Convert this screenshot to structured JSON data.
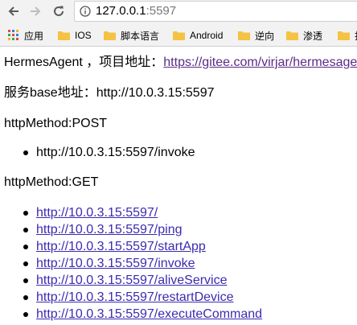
{
  "browser": {
    "url_host": "127.0.0.1",
    "url_port": ":5597",
    "bookmarks": [
      {
        "label": "应用",
        "icon": "apps-grid-icon"
      },
      {
        "label": "IOS",
        "icon": "folder-icon"
      },
      {
        "label": "脚本语言",
        "icon": "folder-icon"
      },
      {
        "label": "Android",
        "icon": "folder-icon"
      },
      {
        "label": "逆向",
        "icon": "folder-icon"
      },
      {
        "label": "渗透",
        "icon": "folder-icon"
      },
      {
        "label": "打",
        "icon": "folder-icon"
      }
    ]
  },
  "page": {
    "intro_prefix": "HermesAgent ，项目地址：",
    "project_link": "https://gitee.com/virjar/hermesagent",
    "service_base": "服务base地址：http://10.0.3.15:5597",
    "post_heading": "httpMethod:POST",
    "post_items": [
      "http://10.0.3.15:5597/invoke"
    ],
    "get_heading": "httpMethod:GET",
    "get_items": [
      "http://10.0.3.15:5597/",
      "http://10.0.3.15:5597/ping",
      "http://10.0.3.15:5597/startApp",
      "http://10.0.3.15:5597/invoke",
      "http://10.0.3.15:5597/aliveService",
      "http://10.0.3.15:5597/restartDevice",
      "http://10.0.3.15:5597/executeCommand"
    ]
  },
  "colors": {
    "link": "#3c2bb0",
    "visited_link": "#5b2a86",
    "chrome_bg": "#f2f2f2",
    "folder": "#f5c343"
  }
}
